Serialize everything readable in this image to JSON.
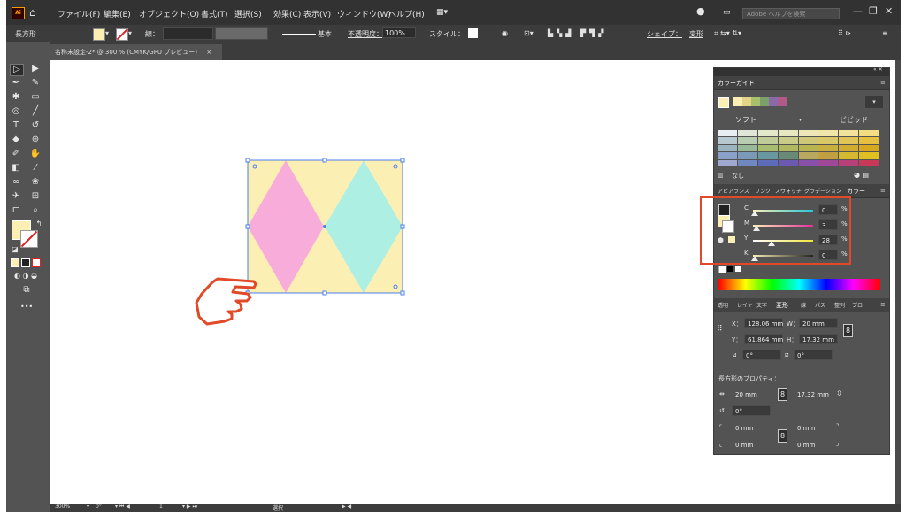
{
  "menubar": {
    "app_icon": "Ai",
    "items": [
      "ファイル(F)",
      "編集(E)",
      "オブジェクト(O)",
      "書式(T)",
      "選択(S)",
      "効果(C)",
      "表示(V)",
      "ウィンドウ(W)",
      "ヘルプ(H)"
    ],
    "search_placeholder": "Adobe ヘルプを検索"
  },
  "controlbar": {
    "object_type": "長方形",
    "stroke_label": "線：",
    "stroke_style": "基本",
    "opacity_label": "不透明度：",
    "opacity_value": "100%",
    "style_label": "スタイル：",
    "shape_label": "シェイプ：",
    "transform_label": "変形"
  },
  "document": {
    "tab_title": "名称未設定-2* @ 300 % (CMYK/GPU プレビュー)",
    "close": "×"
  },
  "statusbar": {
    "zoom": "300%",
    "rotation": "0°",
    "artboard": "1",
    "tool": "選択"
  },
  "color_guide": {
    "title": "カラーガイド",
    "soft_label": "ソフト",
    "vivid_label": "ビビッド",
    "none_label": "なし",
    "base_colors": [
      "#fbefb4",
      "#e6d486",
      "#a8c26b",
      "#7ca06a",
      "#8a6aa8",
      "#b05a8a"
    ],
    "grid_rows": [
      [
        "#e8eef2",
        "#dfe6d6",
        "#e3e8c8",
        "#e6e8c0",
        "#eee8b8",
        "#f0e6a8",
        "#f2e29a",
        "#f4dc80"
      ],
      [
        "#b8c8d0",
        "#b8ccb0",
        "#c0cc98",
        "#c8cc88",
        "#d0c878",
        "#d8c868",
        "#e0c458",
        "#e8c040"
      ],
      [
        "#9cb4c0",
        "#98b898",
        "#a8bc70",
        "#b0b860",
        "#b8b450",
        "#c8b040",
        "#d0ac30",
        "#d8a820"
      ],
      [
        "#8aa0c8",
        "#7a9ab8",
        "#6a98a0",
        "#6a8a78",
        "#b8a860",
        "#c0a040",
        "#d4b830",
        "#e0c020"
      ],
      [
        "#a0a8d0",
        "#7088c0",
        "#5c6cb8",
        "#6a5ab0",
        "#8850a8",
        "#a04898",
        "#b84078",
        "#c83858"
      ]
    ]
  },
  "color_panel": {
    "tabs": [
      "アピアランス",
      "リンク",
      "スウォッチ",
      "グラデーション",
      "カラー"
    ],
    "channels": [
      {
        "label": "C",
        "value": "0",
        "unit": "%"
      },
      {
        "label": "M",
        "value": "3",
        "unit": "%"
      },
      {
        "label": "Y",
        "value": "28",
        "unit": "%"
      },
      {
        "label": "K",
        "value": "0",
        "unit": "%"
      }
    ]
  },
  "transform_panel": {
    "tabs": [
      "透明",
      "レイヤ",
      "文字",
      "変形",
      "線",
      "パス",
      "整列",
      "プロ"
    ],
    "x_label": "X：",
    "x_value": "128.06 mm",
    "y_label": "Y：",
    "y_value": "61.864 mm",
    "w_label": "W：",
    "w_value": "20 mm",
    "h_label": "H：",
    "h_value": "17.32 mm",
    "angle_value": "0°",
    "shear_value": "0°",
    "rect_props_label": "長方形のプロパティ：",
    "rect_w": "20 mm",
    "rect_h": "17.32 mm",
    "rect_angle": "0°",
    "corner_tl": "0 mm",
    "corner_tr": "0 mm",
    "corner_bl": "0 mm",
    "corner_br": "0 mm"
  },
  "artwork": {
    "background_color": "#fbefb4",
    "left_diamond_color": "#f7acd9",
    "right_diamond_color": "#aeefe4"
  },
  "colors": {
    "highlight": "#e04a28",
    "pointer_hand": "#e04a28"
  }
}
